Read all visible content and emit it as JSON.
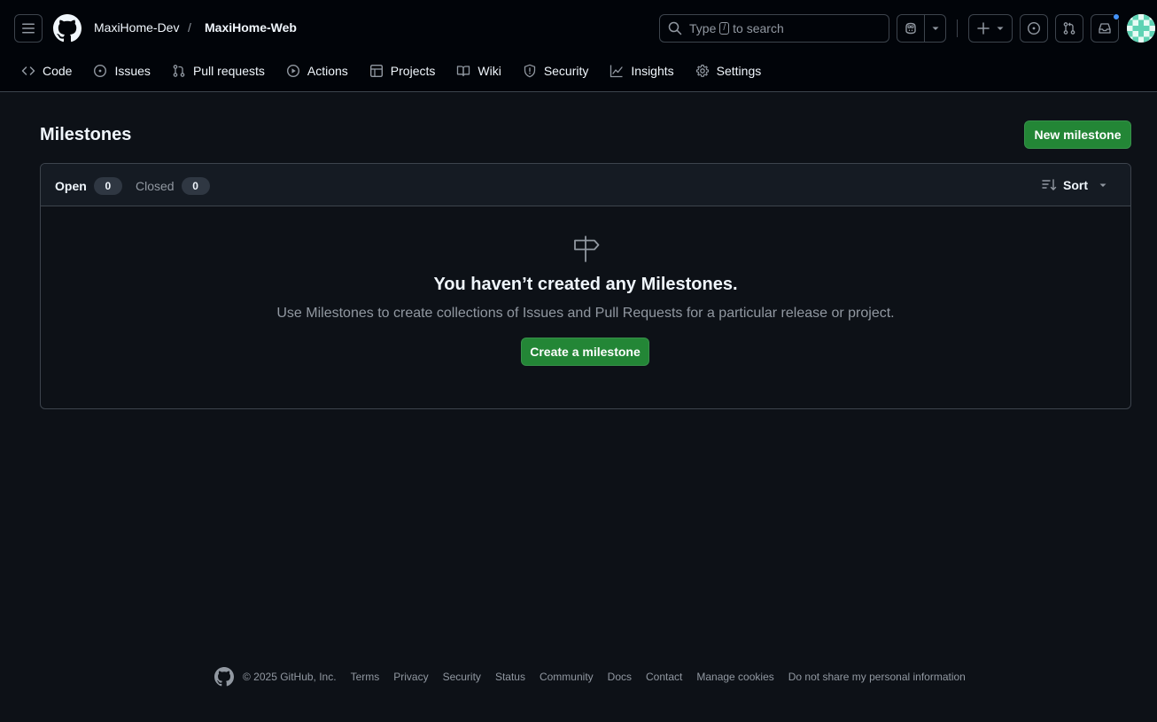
{
  "header": {
    "owner": "MaxiHome-Dev",
    "separator": "/",
    "repo": "MaxiHome-Web",
    "search": {
      "prefix": "Type",
      "key": "/",
      "suffix": "to search"
    },
    "accent_blue": "#4493f8"
  },
  "repo_nav": [
    {
      "label": "Code",
      "icon": "code-icon"
    },
    {
      "label": "Issues",
      "icon": "issue-opened-icon"
    },
    {
      "label": "Pull requests",
      "icon": "git-pull-request-icon"
    },
    {
      "label": "Actions",
      "icon": "play-icon"
    },
    {
      "label": "Projects",
      "icon": "table-icon"
    },
    {
      "label": "Wiki",
      "icon": "book-icon"
    },
    {
      "label": "Security",
      "icon": "shield-icon"
    },
    {
      "label": "Insights",
      "icon": "graph-icon"
    },
    {
      "label": "Settings",
      "icon": "gear-icon"
    }
  ],
  "main": {
    "title": "Milestones",
    "new_button": "New milestone",
    "tabs": {
      "open_label": "Open",
      "open_count": "0",
      "closed_label": "Closed",
      "closed_count": "0"
    },
    "sort_label": "Sort",
    "blank": {
      "title": "You haven’t created any Milestones.",
      "description": "Use Milestones to create collections of Issues and Pull Requests for a particular release or project.",
      "button": "Create a milestone"
    },
    "primary_green": "#238636"
  },
  "footer": {
    "copyright": "© 2025 GitHub, Inc.",
    "links": [
      "Terms",
      "Privacy",
      "Security",
      "Status",
      "Community",
      "Docs",
      "Contact",
      "Manage cookies",
      "Do not share my personal information"
    ]
  }
}
